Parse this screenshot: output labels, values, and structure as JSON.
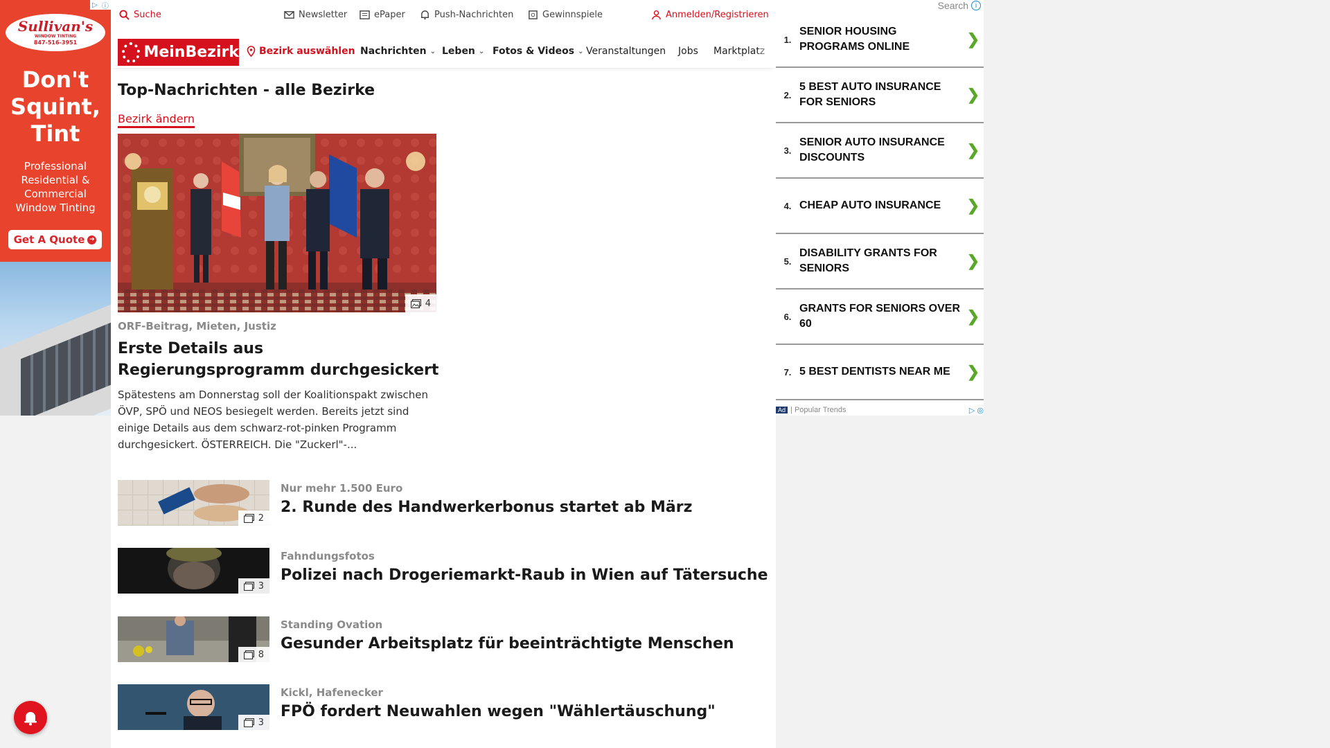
{
  "left_ad": {
    "brand": "Sullivan's",
    "brand_tagline": "WINDOW TINTING",
    "phone": "847-516-3951",
    "headline_1": "Don't",
    "headline_2": "Squint,",
    "headline_3": "Tint",
    "body_1": "Professional",
    "body_2": "Residential &",
    "body_3": "Commercial",
    "body_4": "Window Tinting",
    "cta": "Get A Quote"
  },
  "util_bar": {
    "search": "Suche",
    "newsletter": "Newsletter",
    "epaper": "ePaper",
    "push": "Push-Nachrichten",
    "gewinnspiele": "Gewinnspiele",
    "login": "Anmelden/Registrieren"
  },
  "nav": {
    "logo": "MeinBezirk",
    "bezirk": "Bezirk auswählen",
    "items": [
      {
        "label": "Nachrichten"
      },
      {
        "label": "Leben"
      },
      {
        "label": "Fotos & Videos"
      },
      {
        "label": "Veranstaltungen"
      },
      {
        "label": "Jobs"
      },
      {
        "label": "Marktplatz"
      }
    ]
  },
  "main": {
    "section_title": "Top-Nachrichten - alle Bezirke",
    "change_bezirk": "Bezirk ändern",
    "hero": {
      "image_count": "4",
      "kicker": "ORF-Beitrag, Mieten, Justiz",
      "title": "Erste Details aus Regierungsprogramm durchgesickert",
      "teaser": "Spätestens am Donnerstag soll der Koalitionspakt zwischen ÖVP, SPÖ und NEOS besiegelt werden. Bereits jetzt sind einige Details aus dem schwarz-rot-pinken Programm durchgesickert.  ÖSTERREICH. Die \"Zuckerl\"-..."
    },
    "articles": [
      {
        "kicker": "Nur mehr 1.500 Euro",
        "title": "2. Runde des Handwerkerbonus startet ab März",
        "image_count": "2"
      },
      {
        "kicker": "Fahndungsfotos",
        "title": "Polizei nach Drogeriemarkt-Raub in Wien auf Tätersuche",
        "image_count": "3"
      },
      {
        "kicker": "Standing Ovation",
        "title": "Gesunder Arbeitsplatz für beeinträchtigte Menschen",
        "image_count": "8"
      },
      {
        "kicker": "Kickl, Hafenecker",
        "title": "FPÖ fordert Neuwahlen wegen \"Wählertäuschung\"",
        "image_count": "3"
      }
    ]
  },
  "right_ad": {
    "search": "Search",
    "items": [
      {
        "num": "1.",
        "text": "SENIOR HOUSING PROGRAMS ONLINE"
      },
      {
        "num": "2.",
        "text": "5 BEST AUTO INSURANCE FOR SENIORS"
      },
      {
        "num": "3.",
        "text": "SENIOR AUTO INSURANCE DISCOUNTS"
      },
      {
        "num": "4.",
        "text": "CHEAP AUTO INSURANCE"
      },
      {
        "num": "5.",
        "text": "DISABILITY GRANTS FOR SENIORS"
      },
      {
        "num": "6.",
        "text": "GRANTS FOR SENIORS OVER 60"
      },
      {
        "num": "7.",
        "text": "5 BEST DENTISTS NEAR ME"
      }
    ],
    "ad_label": "Ad",
    "footer": "Popular Trends"
  },
  "colors": {
    "brand_red": "#d6111e",
    "ad_red": "#e8432c",
    "arrow_green": "#5aa82a"
  }
}
